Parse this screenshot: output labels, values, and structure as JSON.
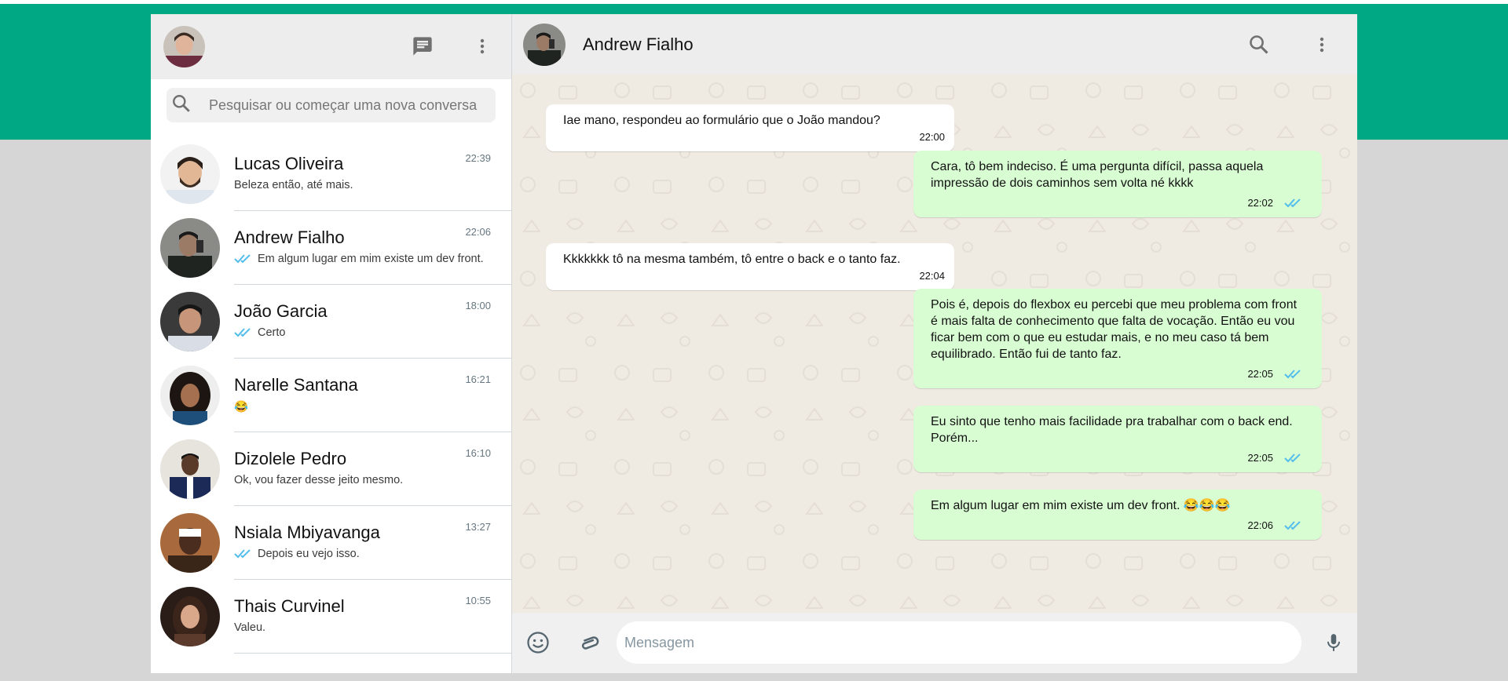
{
  "colors": {
    "brand": "#00a884",
    "outgoing_bubble": "#d9fdd3",
    "read_ticks": "#53bdeb"
  },
  "sidebar": {
    "search_placeholder": "Pesquisar ou começar uma nova conversa",
    "chats": [
      {
        "name": "Lucas Oliveira",
        "time": "22:39",
        "preview": "Beleza então, até mais.",
        "read": false
      },
      {
        "name": "Andrew Fialho",
        "time": "22:06",
        "preview": "Em algum lugar em mim existe um dev front.",
        "read": true
      },
      {
        "name": "João Garcia",
        "time": "18:00",
        "preview": "Certo",
        "read": true
      },
      {
        "name": "Narelle Santana",
        "time": "16:21",
        "preview": "😂",
        "read": false
      },
      {
        "name": "Dizolele Pedro",
        "time": "16:10",
        "preview": "Ok, vou fazer desse jeito mesmo.",
        "read": false
      },
      {
        "name": "Nsiala Mbiyavanga",
        "time": "13:27",
        "preview": "Depois eu vejo isso.",
        "read": true
      },
      {
        "name": "Thais Curvinel",
        "time": "10:55",
        "preview": "Valeu.",
        "read": false
      }
    ]
  },
  "conversation": {
    "contact_name": "Andrew Fialho",
    "messages": [
      {
        "direction": "in",
        "text": "Iae mano, respondeu ao formulário que o João mandou?",
        "time": "22:00"
      },
      {
        "direction": "out",
        "text": "Cara, tô bem indeciso. É uma pergunta difícil, passa aquela impressão de dois caminhos sem volta né kkkk",
        "time": "22:02"
      },
      {
        "direction": "in",
        "text": "Kkkkkkk tô na mesma também, tô entre o back e o tanto faz.",
        "time": "22:04"
      },
      {
        "direction": "out",
        "text": "Pois é, depois do flexbox eu percebi que meu problema com front é mais falta de conhecimento que falta de vocação. Então eu vou ficar bem com o que eu estudar mais, e no meu caso tá bem equilibrado. Então fui de tanto faz.",
        "time": "22:05"
      },
      {
        "direction": "out",
        "text": "Eu sinto que tenho mais facilidade pra trabalhar com o back end. Porém...",
        "time": "22:05"
      },
      {
        "direction": "out",
        "text": "Em algum lugar em mim existe um dev front. 😂😂😂",
        "time": "22:06"
      }
    ],
    "composer_placeholder": "Mensagem"
  }
}
